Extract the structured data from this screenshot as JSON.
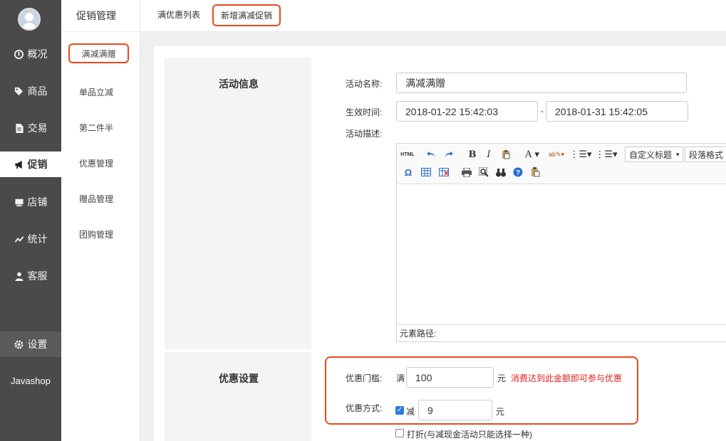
{
  "leftnav": {
    "items": [
      {
        "label": "概况",
        "icon": "overview-icon"
      },
      {
        "label": "商品",
        "icon": "tag-icon"
      },
      {
        "label": "交易",
        "icon": "document-icon"
      },
      {
        "label": "促销",
        "icon": "megaphone-icon"
      },
      {
        "label": "店铺",
        "icon": "store-icon"
      },
      {
        "label": "统计",
        "icon": "chart-line-icon"
      },
      {
        "label": "客服",
        "icon": "user-icon"
      }
    ],
    "settings_label": "设置",
    "brand": "Javashop"
  },
  "subnav": {
    "title": "促销管理",
    "items": [
      "满减满赠",
      "单品立减",
      "第二件半",
      "优惠管理",
      "赠品管理",
      "团购管理"
    ]
  },
  "tabs": [
    {
      "label": "满优惠列表"
    },
    {
      "label": "新增满减促销"
    }
  ],
  "activity_info": {
    "section_title": "活动信息",
    "name_label": "活动名称:",
    "name_value": "满减满赠",
    "time_label": "生效时间:",
    "start_time": "2018-01-22 15:42:03",
    "time_separator": "-",
    "end_time": "2018-01-31 15:42:05",
    "desc_label": "活动描述:"
  },
  "editor": {
    "html_btn": "HTML",
    "custom_heading": "自定义标题",
    "paragraph_format": "段落格式",
    "footer": "元素路径:"
  },
  "discount": {
    "section_title": "优惠设置",
    "threshold_label": "优惠门槛:",
    "threshold_prefix": "满",
    "threshold_value": "100",
    "threshold_unit": "元",
    "threshold_hint": "消费达到此金额即可参与优惠",
    "method_label": "优惠方式:",
    "reduce_label": "减",
    "reduce_value": "9",
    "reduce_unit": "元",
    "discount_option": "打折(与减现金活动只能选择一种)"
  },
  "colors": {
    "accent": "#e8491d",
    "nav_bg": "#4a4a4a",
    "hint": "#e02020"
  }
}
